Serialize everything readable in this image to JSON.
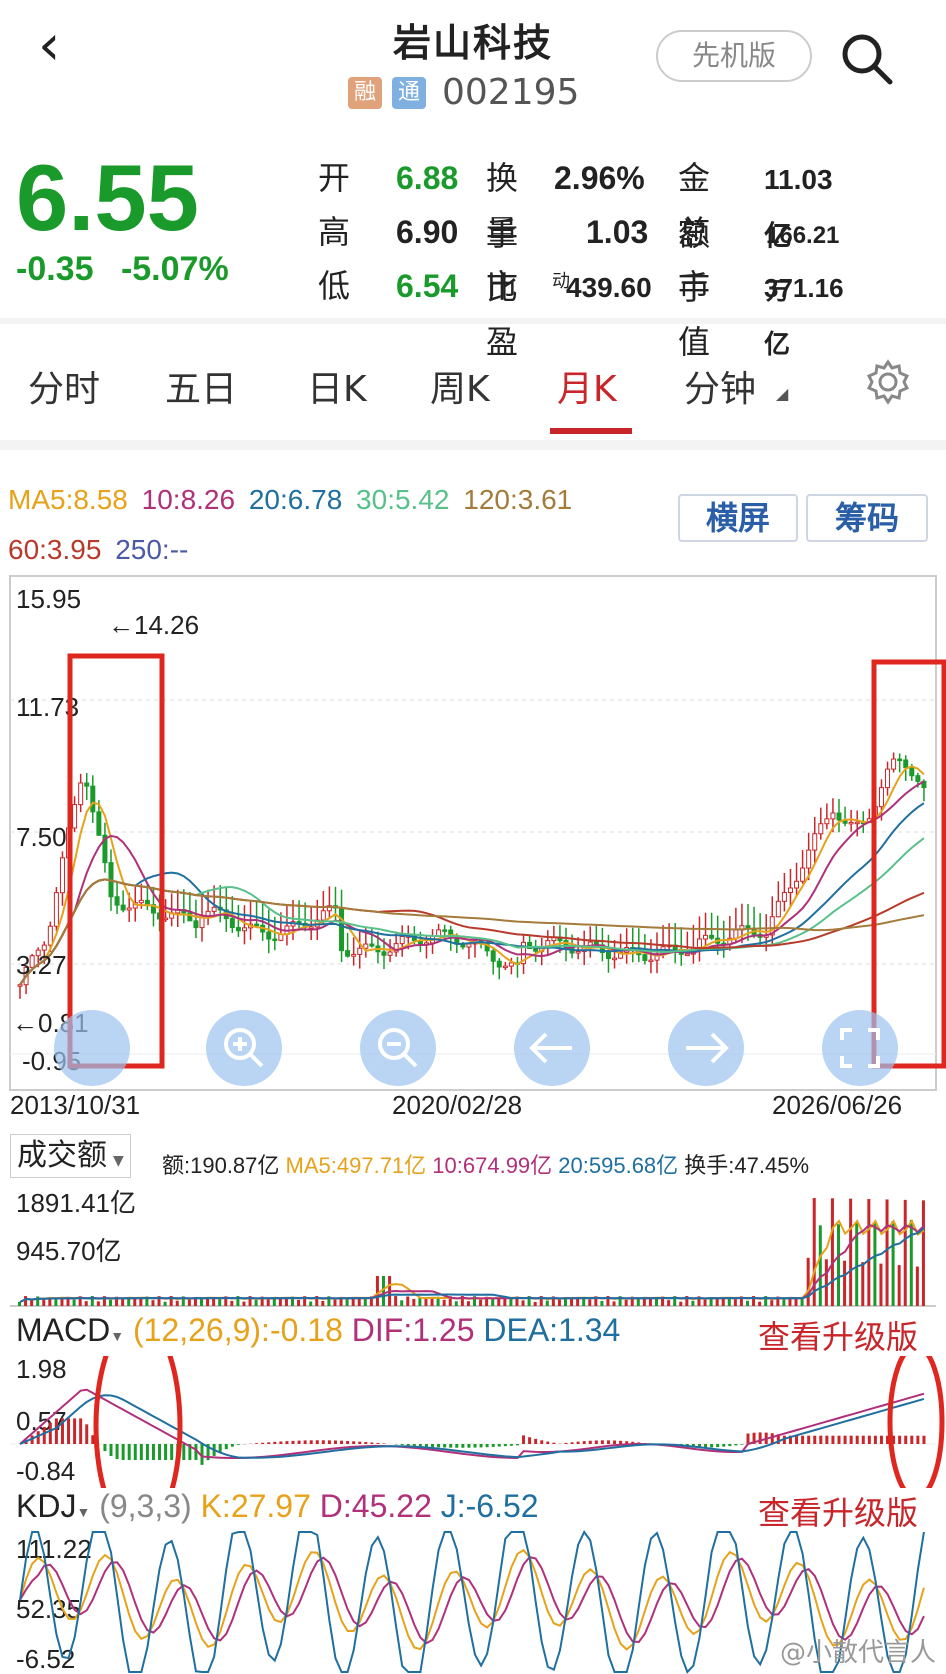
{
  "header": {
    "title": "岩山科技",
    "tag1": "融",
    "tag2": "通",
    "code": "002195",
    "mode_button": "先机版"
  },
  "quote": {
    "price": "6.55",
    "change": "-0.35",
    "change_pct": "-5.07%"
  },
  "stats": {
    "open_label": "开",
    "open": "6.88",
    "turnover_label": "换手",
    "turnover": "2.96%",
    "amount_label": "金额",
    "amount": "11.03亿",
    "high_label": "高",
    "high": "6.90",
    "volratio_label": "量比",
    "volratio": "1.03",
    "total_label": "总手",
    "total": "166.21万",
    "low_label": "低",
    "low": "6.54",
    "pe_label": "市盈",
    "pe_sup": "动",
    "pe": "439.60",
    "mcap_label": "市值",
    "mcap": "371.16亿"
  },
  "tabs": [
    "分时",
    "五日",
    "日K",
    "周K",
    "月K",
    "分钟"
  ],
  "active_tab": "月K",
  "ma_row": {
    "ma5": "MA5:8.58",
    "ma10": "10:8.26",
    "ma20": "20:6.78",
    "ma30": "30:5.42",
    "ma120": "120:3.61",
    "ma60": "60:3.95",
    "ma250": "250:--"
  },
  "side_buttons": {
    "landscape": "横屏",
    "chips": "筹码"
  },
  "kchart": {
    "y_labels": [
      "15.95",
      "11.73",
      "7.50",
      "3.27",
      "-0.95"
    ],
    "max_label": "←14.26",
    "min_label": "←0.81",
    "dates": [
      "2013/10/31",
      "2020/02/28",
      "2026/06/26"
    ]
  },
  "volume": {
    "selector": "成交额",
    "amount": "额:190.87亿",
    "ma5": "MA5:497.71亿",
    "ma10": "10:674.99亿",
    "ma20": "20:595.68亿",
    "turnover": "换手:47.45%",
    "y1": "1891.41亿",
    "y2": "945.70亿"
  },
  "macd": {
    "selector": "MACD",
    "params": "(12,26,9):-0.18",
    "dif": "DIF:1.25",
    "dea": "DEA:1.34",
    "upgrade": "查看升级版",
    "y1": "1.98",
    "y2": "0.57",
    "y3": "-0.84"
  },
  "kdj": {
    "selector": "KDJ",
    "params": "(9,3,3)",
    "k": "K:27.97",
    "d": "D:45.22",
    "j": "J:-6.52",
    "upgrade": "查看升级版",
    "y1": "111.22",
    "y2": "52.35",
    "y3": "-6.52"
  },
  "watermark": "@小散代言人",
  "colors": {
    "up": "#c8262a",
    "down": "#1a9a2a",
    "ma5": "#e6a21a",
    "ma10": "#b0307a",
    "ma20": "#1f6fa0",
    "ma30": "#58c18a",
    "ma60": "#b83a2a",
    "ma120": "#a47b3a",
    "ma250": "#4a5aa8"
  }
}
